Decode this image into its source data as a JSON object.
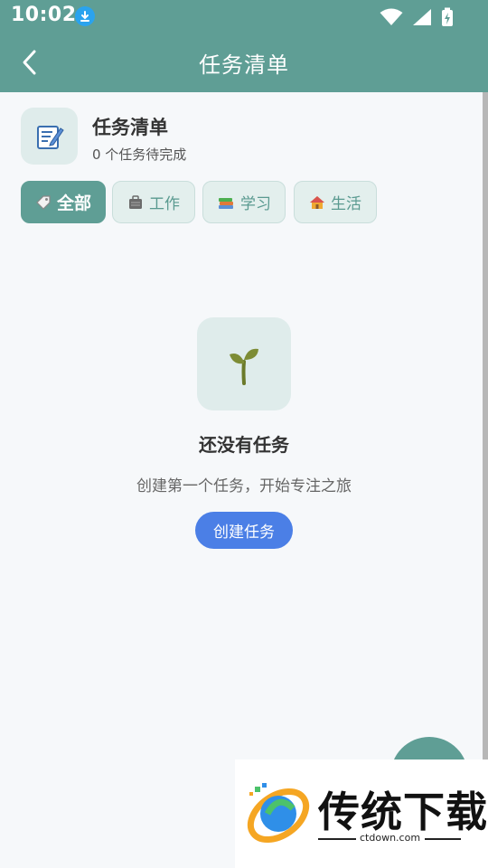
{
  "status_bar": {
    "time": "10:02",
    "icons": [
      "download-icon",
      "wifi-icon",
      "signal-icon",
      "battery-charging-icon"
    ]
  },
  "app_bar": {
    "title": "任务清单",
    "back_icon": "chevron-left-icon"
  },
  "header": {
    "icon": "memo-icon",
    "title": "任务清单",
    "subtitle": "0 个任务待完成"
  },
  "tabs": [
    {
      "label": "全部",
      "icon": "tag-icon",
      "active": true
    },
    {
      "label": "工作",
      "icon": "briefcase-icon",
      "active": false
    },
    {
      "label": "学习",
      "icon": "books-icon",
      "active": false
    },
    {
      "label": "生活",
      "icon": "house-icon",
      "active": false
    }
  ],
  "empty_state": {
    "icon": "seedling-icon",
    "title": "还没有任务",
    "subtitle": "创建第一个任务，开始专注之旅",
    "button_label": "创建任务"
  },
  "watermark": {
    "brand": "传统下载",
    "url": "ctdown.com"
  },
  "colors": {
    "primary": "#5f9e95",
    "accent_button": "#4b7fe6",
    "tab_bg": "#e3efed",
    "background": "#f6f8fa"
  }
}
